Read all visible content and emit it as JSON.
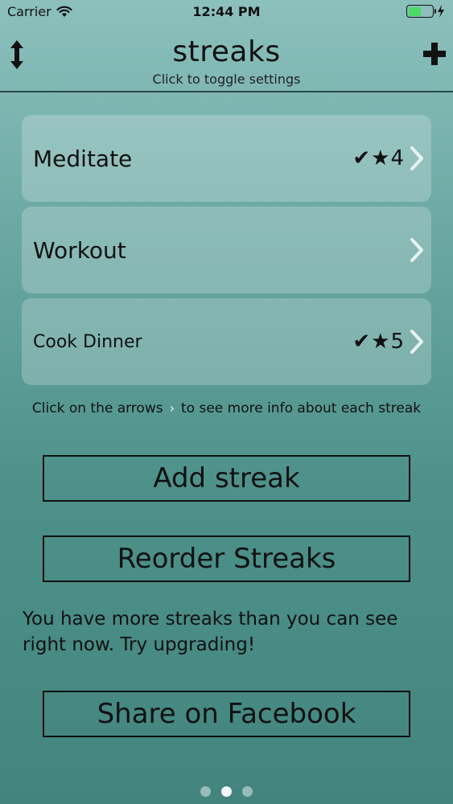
{
  "status": {
    "carrier": "Carrier",
    "time": "12:44 PM"
  },
  "nav": {
    "title": "streaks",
    "subtitle": "Click to toggle settings",
    "left_icon": "vertical-arrows-icon",
    "right_icon": "plus-icon"
  },
  "streaks": [
    {
      "name": "Meditate",
      "check": "✔",
      "star": "★",
      "count": "4"
    },
    {
      "name": "Workout"
    },
    {
      "name": "Cook Dinner",
      "check": "✔",
      "star": "★",
      "count": "5"
    }
  ],
  "hint": {
    "before": "Click on the arrows",
    "after": "to see more info about each streak"
  },
  "buttons": {
    "add": "Add streak",
    "reorder": "Reorder Streaks",
    "share": "Share on Facebook"
  },
  "upgrade_text": "You have more streaks than you can see right now. Try upgrading!",
  "colors": {
    "battery": "#4cd964",
    "chevron": "#e8f2f1"
  }
}
